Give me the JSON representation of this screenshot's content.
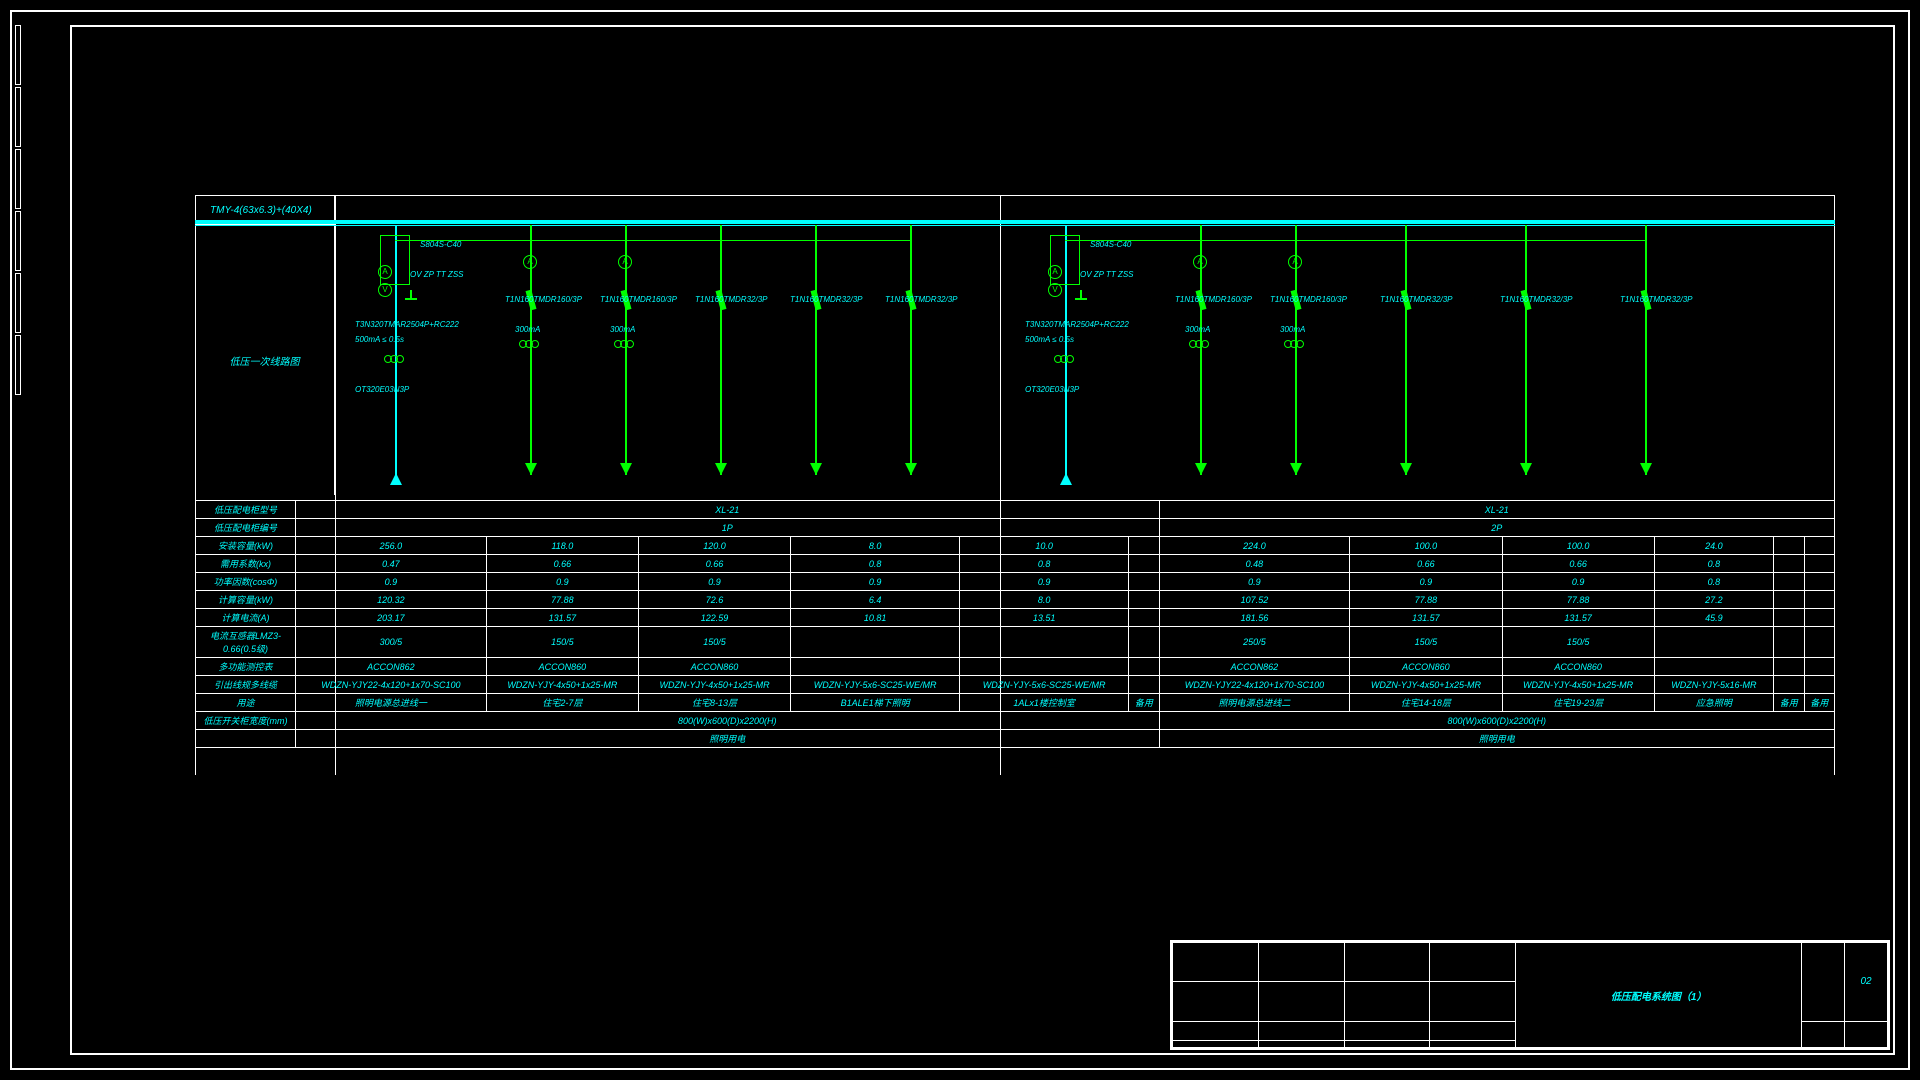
{
  "busbar_label": "TMY-4(63x6.3)+(40X4)",
  "section_label": "低压一次线路图",
  "title": "低压配电系统图（1）",
  "title_num": "02",
  "panel1": {
    "main_switch": "S804S-C40",
    "protection": "OV ZP TT ZSS",
    "main_breaker": "T3N320TMAR2504P+RC222",
    "trip": "500mA ≤ 0.5s",
    "isolator": "OT320E03N3P",
    "feeders": [
      {
        "breaker": "T1N160TMDR160/3P",
        "rcd": "300mA"
      },
      {
        "breaker": "T1N160TMDR160/3P",
        "rcd": "300mA"
      },
      {
        "breaker": "T1N160TMDR32/3P",
        "rcd": ""
      },
      {
        "breaker": "T1N160TMDR32/3P",
        "rcd": ""
      },
      {
        "breaker": "T1N160TMDR32/3P",
        "rcd": ""
      }
    ]
  },
  "panel2": {
    "main_switch": "S804S-C40",
    "protection": "OV ZP TT ZSS",
    "main_breaker": "T3N320TMAR2504P+RC222",
    "trip": "500mA ≤ 0.5s",
    "isolator": "OT320E03N3P",
    "feeders": [
      {
        "breaker": "T1N160TMDR160/3P",
        "rcd": "300mA"
      },
      {
        "breaker": "T1N160TMDR160/3P",
        "rcd": "300mA"
      },
      {
        "breaker": "T1N160TMDR32/3P",
        "rcd": ""
      },
      {
        "breaker": "T1N160TMDR32/3P",
        "rcd": ""
      },
      {
        "breaker": "T1N160TMDR32/3P",
        "rcd": ""
      }
    ]
  },
  "rows": {
    "r1": {
      "hdr": "低压配电柜型号",
      "p1": "XL-21",
      "p2": "XL-21"
    },
    "r2": {
      "hdr": "低压配电柜编号",
      "p1": "1P",
      "p2": "2P"
    },
    "r3": {
      "hdr": "安装容量(kW)",
      "c": [
        "256.0",
        "118.0",
        "120.0",
        "8.0",
        "10.0",
        "",
        "224.0",
        "100.0",
        "100.0",
        "24.0",
        "",
        ""
      ]
    },
    "r4": {
      "hdr": "需用系数(kx)",
      "c": [
        "0.47",
        "0.66",
        "0.66",
        "0.8",
        "0.8",
        "",
        "0.48",
        "0.66",
        "0.66",
        "0.8",
        "",
        ""
      ]
    },
    "r5": {
      "hdr": "功率因数(cosΦ)",
      "c": [
        "0.9",
        "0.9",
        "0.9",
        "0.9",
        "0.9",
        "",
        "0.9",
        "0.9",
        "0.9",
        "0.8",
        "",
        ""
      ]
    },
    "r6": {
      "hdr": "计算容量(kW)",
      "c": [
        "120.32",
        "77.88",
        "72.6",
        "6.4",
        "8.0",
        "",
        "107.52",
        "77.88",
        "77.88",
        "27.2",
        "",
        ""
      ]
    },
    "r7": {
      "hdr": "计算电流(A)",
      "c": [
        "203.17",
        "131.57",
        "122.59",
        "10.81",
        "13.51",
        "",
        "181.56",
        "131.57",
        "131.57",
        "45.9",
        "",
        ""
      ]
    },
    "r8": {
      "hdr": "电流互感器LMZ3-0.66(0.5级)",
      "c": [
        "300/5",
        "150/5",
        "150/5",
        "",
        "",
        "",
        "250/5",
        "150/5",
        "150/5",
        "",
        "",
        ""
      ]
    },
    "r9": {
      "hdr": "多功能测控表",
      "c": [
        "ACCON862",
        "ACCON860",
        "ACCON860",
        "",
        "",
        "",
        "ACCON862",
        "ACCON860",
        "ACCON860",
        "",
        "",
        ""
      ]
    },
    "r10": {
      "hdr": "引出线规多线缆",
      "c": [
        "WDZN-YJY22-4x120+1x70-SC100",
        "WDZN-YJY-4x50+1x25-MR",
        "WDZN-YJY-4x50+1x25-MR",
        "WDZN-YJY-5x6-SC25-WE/MR",
        "WDZN-YJY-5x6-SC25-WE/MR",
        "",
        "WDZN-YJY22-4x120+1x70-SC100",
        "WDZN-YJY-4x50+1x25-MR",
        "WDZN-YJY-4x50+1x25-MR",
        "WDZN-YJY-5x16-MR",
        "",
        ""
      ]
    },
    "r11": {
      "hdr": "用途",
      "c": [
        "照明电源总进线一",
        "住宅2-7层",
        "住宅8-13层",
        "B1ALE1梯下照明",
        "1ALx1楼控制室",
        "备用",
        "照明电源总进线二",
        "住宅14-18层",
        "住宅19-23层",
        "应急照明",
        "备用",
        "备用"
      ]
    },
    "r12": {
      "hdr": "低压开关柜宽度(mm)",
      "p1": "800(W)x600(D)x2200(H)",
      "p2": "800(W)x600(D)x2200(H)"
    },
    "r13": {
      "hdr": "",
      "p1": "照明用电",
      "p2": "照明用电"
    }
  }
}
